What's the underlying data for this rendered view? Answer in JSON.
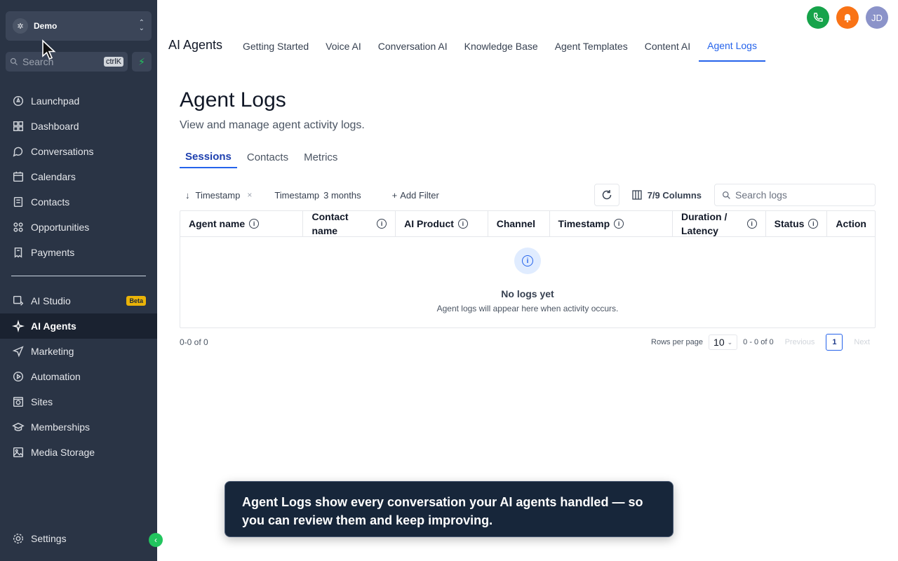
{
  "sidebar": {
    "account_name": "Demo",
    "search_placeholder": "Search",
    "search_shortcut": "ctrlK",
    "items": [
      {
        "label": "Launchpad"
      },
      {
        "label": "Dashboard"
      },
      {
        "label": "Conversations"
      },
      {
        "label": "Calendars"
      },
      {
        "label": "Contacts"
      },
      {
        "label": "Opportunities"
      },
      {
        "label": "Payments"
      }
    ],
    "ai_items": [
      {
        "label": "AI Studio",
        "badge": "Beta"
      },
      {
        "label": "AI Agents"
      },
      {
        "label": "Marketing"
      },
      {
        "label": "Automation"
      },
      {
        "label": "Sites"
      },
      {
        "label": "Memberships"
      },
      {
        "label": "Media Storage"
      }
    ],
    "settings_label": "Settings"
  },
  "topbar": {
    "brand": "AI Agents",
    "tabs": [
      "Getting Started",
      "Voice AI",
      "Conversation AI",
      "Knowledge Base",
      "Agent Templates",
      "Content AI",
      "Agent Logs"
    ],
    "active_tab": "Agent Logs",
    "avatar_initials": "JD"
  },
  "page": {
    "title": "Agent Logs",
    "subtitle": "View and manage agent activity logs.",
    "subtabs": [
      "Sessions",
      "Contacts",
      "Metrics"
    ]
  },
  "toolbar": {
    "sort_chip": "Timestamp",
    "filter_chip_label": "Timestamp",
    "filter_chip_value": "3 months",
    "add_filter": "Add Filter",
    "columns_label": "7/9 Columns",
    "search_placeholder": "Search logs"
  },
  "table": {
    "headers": [
      "Agent name",
      "Contact name",
      "AI Product",
      "Channel",
      "Timestamp",
      "Duration / Latency",
      "Status",
      "Action"
    ],
    "empty_title": "No logs yet",
    "empty_desc": "Agent logs will appear here when activity occurs."
  },
  "footer": {
    "range": "0-0 of 0",
    "rows_per_page_label": "Rows per page",
    "rows_per_page": "10",
    "page_range": "0 - 0 of 0",
    "previous": "Previous",
    "current_page": "1",
    "next": "Next"
  },
  "tooltip": {
    "text": "Agent Logs show every conversation your AI agents handled — so you can review them and keep improving."
  },
  "colors": {
    "sidebar_bg": "#2a3445",
    "accent": "#2563eb",
    "phone": "#16a34a",
    "bell": "#f97316",
    "avatar": "#8b93c9",
    "beta": "#eab308"
  }
}
